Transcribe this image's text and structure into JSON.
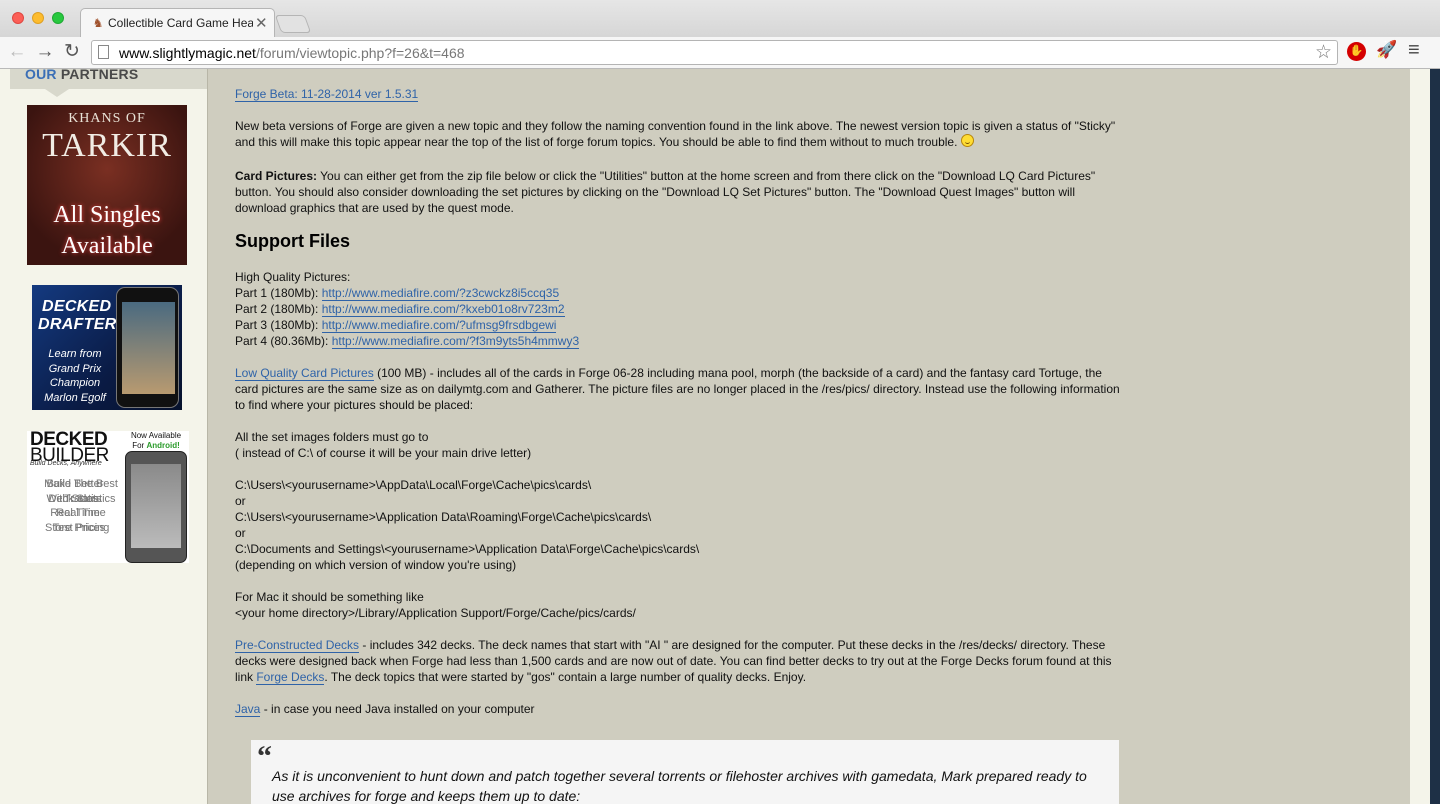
{
  "browser": {
    "tab_title": "Collectible Card Game Hea",
    "tab_close": "✕",
    "url_host": "www.slightlymagic.net",
    "url_path": "/forum/viewtopic.php?f=26&t=468",
    "nav": {
      "back": "←",
      "forward": "→",
      "reload": "↻"
    },
    "star": "☆",
    "menu": "≡"
  },
  "sidebar": {
    "partners_word1": "OUR",
    "partners_word2": "PARTNERS",
    "ad_khans": {
      "line1": "KHANS OF",
      "line2": "TARKIR",
      "line3": "All Singles",
      "line4": "Available"
    },
    "ad_drafter": {
      "line1": "DECKED",
      "line2": "DRAFTER",
      "line3": "Learn from",
      "line4": "Grand Prix",
      "line5": "Champion",
      "line6": "Marlon Egolf"
    },
    "ad_builder": {
      "line1": "DECKED",
      "line2": "BUILDER",
      "tagline": "Build Decks, Anywhere",
      "now_available": "Now Available",
      "for": "For",
      "platform": "Android!",
      "features": [
        "Build Better",
        "Make The Best Trades",
        "Deck Stats",
        "With Statistics",
        "Real Time",
        "Real Time",
        "Store Prices",
        "Test Pricing"
      ]
    }
  },
  "post": {
    "beta_link": "Forge Beta: 11-28-2014 ver 1.5.31",
    "intro": "New beta versions of Forge are given a new topic and they follow the naming convention found in the link above. The newest version topic is given a status of \"Sticky\" and this will make this topic appear near the top of the list of forge forum topics. You should be able to find them without to much trouble.",
    "card_pictures_label": "Card Pictures:",
    "card_pictures_text": " You can either get from the zip file below or click the \"Utilities\" button at the home screen and from there click on the \"Download LQ Card Pictures\" button. You should also consider downloading the set pictures by clicking on the \"Download LQ Set Pictures\" button. The \"Download Quest Images\" button will download graphics that are used by the quest mode.",
    "support_heading": "Support Files",
    "hq_title": "High Quality Pictures:",
    "hq_parts": [
      {
        "label": "Part 1 (180Mb): ",
        "link": "http://www.mediafire.com/?z3cwckz8i5ccq35"
      },
      {
        "label": "Part 2 (180Mb): ",
        "link": "http://www.mediafire.com/?kxeb01o8rv723m2"
      },
      {
        "label": "Part 3 (180Mb): ",
        "link": "http://www.mediafire.com/?ufmsg9frsdbgewi"
      },
      {
        "label": "Part 4 (80.36Mb): ",
        "link": "http://www.mediafire.com/?f3m9yts5h4mmwy3"
      }
    ],
    "lq_link": "Low Quality Card Pictures",
    "lq_text": " (100 MB) - includes all of the cards in Forge 06-28 including mana pool, morph (the backside of a card) and the fantasy card Tortuge, the card pictures are the same size as on dailymtg.com and Gatherer. The picture files are no longer placed in the /res/pics/ directory. Instead use the following information to find where your pictures should be placed:",
    "set_images_1": "All the set images folders must go to",
    "set_images_2": "( instead of C:\\ of course it will be your main drive letter)",
    "path1": "C:\\Users\\<yourusername>\\AppData\\Local\\Forge\\Cache\\pics\\cards\\",
    "or1": "or",
    "path2": "C:\\Users\\<yourusername>\\Application Data\\Roaming\\Forge\\Cache\\pics\\cards\\",
    "or2": "or",
    "path3": "C:\\Documents and Settings\\<yourusername>\\Application Data\\Forge\\Cache\\pics\\cards\\",
    "depending": "(depending on which version of window you're using)",
    "mac_1": "For Mac it should be something like",
    "mac_2": "<your home directory>/Library/Application Support/Forge/Cache/pics/cards/",
    "decks_link": "Pre-Constructed Decks",
    "decks_text": " - includes 342 decks. The deck names that start with \"AI \" are designed for the computer. Put these decks in the /res/decks/ directory. These decks were designed back when Forge had less than 1,500 cards and are now out of date. You can find better decks to try out at the Forge Decks forum found at this link ",
    "forge_decks_link": "Forge Decks",
    "decks_text_end": ". The deck topics that were started by \"gos\" contain a large number of quality decks. Enjoy.",
    "java_link": "Java",
    "java_text": " - in case you need Java installed on your computer",
    "quote_mark": "“",
    "quote_text": "As it is unconvenient to hunt down and patch together several torrents or filehoster archives with gamedata, Mark prepared ready to use archives for forge and keeps them up to date:"
  }
}
